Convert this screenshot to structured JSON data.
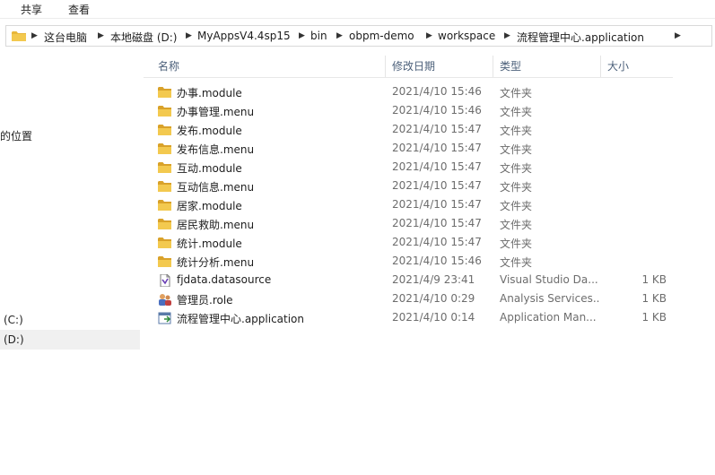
{
  "ribbon": {
    "tabs": [
      "共享",
      "查看"
    ]
  },
  "address": {
    "crumbs": [
      "这台电脑",
      "本地磁盘 (D:)",
      "MyAppsV4.4sp15",
      "bin",
      "obpm-demo",
      "workspace",
      "流程管理中心.application"
    ]
  },
  "nav": {
    "partial_label": "的位置",
    "drive_c": "(C:)",
    "drive_d": "(D:)"
  },
  "columns": {
    "name": "名称",
    "date": "修改日期",
    "type": "类型",
    "size": "大小"
  },
  "files": [
    {
      "name": "办事.module",
      "date": "2021/4/10 15:46",
      "type": "文件夹",
      "size": "",
      "icon": "folder-icon"
    },
    {
      "name": "办事管理.menu",
      "date": "2021/4/10 15:46",
      "type": "文件夹",
      "size": "",
      "icon": "folder-icon"
    },
    {
      "name": "发布.module",
      "date": "2021/4/10 15:47",
      "type": "文件夹",
      "size": "",
      "icon": "folder-icon"
    },
    {
      "name": "发布信息.menu",
      "date": "2021/4/10 15:47",
      "type": "文件夹",
      "size": "",
      "icon": "folder-icon"
    },
    {
      "name": "互动.module",
      "date": "2021/4/10 15:47",
      "type": "文件夹",
      "size": "",
      "icon": "folder-icon"
    },
    {
      "name": "互动信息.menu",
      "date": "2021/4/10 15:47",
      "type": "文件夹",
      "size": "",
      "icon": "folder-icon"
    },
    {
      "name": "居家.module",
      "date": "2021/4/10 15:47",
      "type": "文件夹",
      "size": "",
      "icon": "folder-icon"
    },
    {
      "name": "居民救助.menu",
      "date": "2021/4/10 15:47",
      "type": "文件夹",
      "size": "",
      "icon": "folder-icon"
    },
    {
      "name": "统计.module",
      "date": "2021/4/10 15:47",
      "type": "文件夹",
      "size": "",
      "icon": "folder-icon"
    },
    {
      "name": "统计分析.menu",
      "date": "2021/4/10 15:46",
      "type": "文件夹",
      "size": "",
      "icon": "folder-icon"
    },
    {
      "name": "fjdata.datasource",
      "date": "2021/4/9 23:41",
      "type": "Visual Studio Da...",
      "size": "1 KB",
      "icon": "datasource-file-icon"
    },
    {
      "name": "管理员.role",
      "date": "2021/4/10 0:29",
      "type": "Analysis Services...",
      "size": "1 KB",
      "icon": "role-file-icon"
    },
    {
      "name": "流程管理中心.application",
      "date": "2021/4/10 0:14",
      "type": "Application Man...",
      "size": "1 KB",
      "icon": "application-file-icon"
    }
  ],
  "colors": {
    "folder": "#e8b73a",
    "header_text": "#4c607a",
    "muted_text": "#6d6d6d",
    "selected_bg": "#f0f0f0"
  }
}
